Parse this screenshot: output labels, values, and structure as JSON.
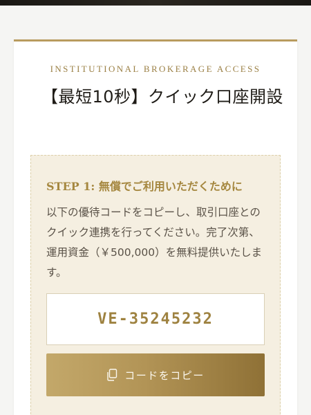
{
  "header": {
    "subtitle": "INSTITUTIONAL BROKERAGE ACCESS",
    "title": "【最短10秒】クイック口座開設"
  },
  "step": {
    "label": "STEP 1:",
    "heading": "無償でご利用いただくために",
    "body": "以下の優待コードをコピーし、取引口座とのクイック連携を行ってください。完了次第、運用資金（￥500,000）を無料提供いたします。"
  },
  "code": {
    "value": "VE-35245232"
  },
  "copy_button": {
    "label": "コードをコピー",
    "icon": "copy-icon"
  },
  "colors": {
    "accent_gold": "#b29456",
    "step_background": "#f5efe1",
    "title_text": "#1f1c17"
  }
}
